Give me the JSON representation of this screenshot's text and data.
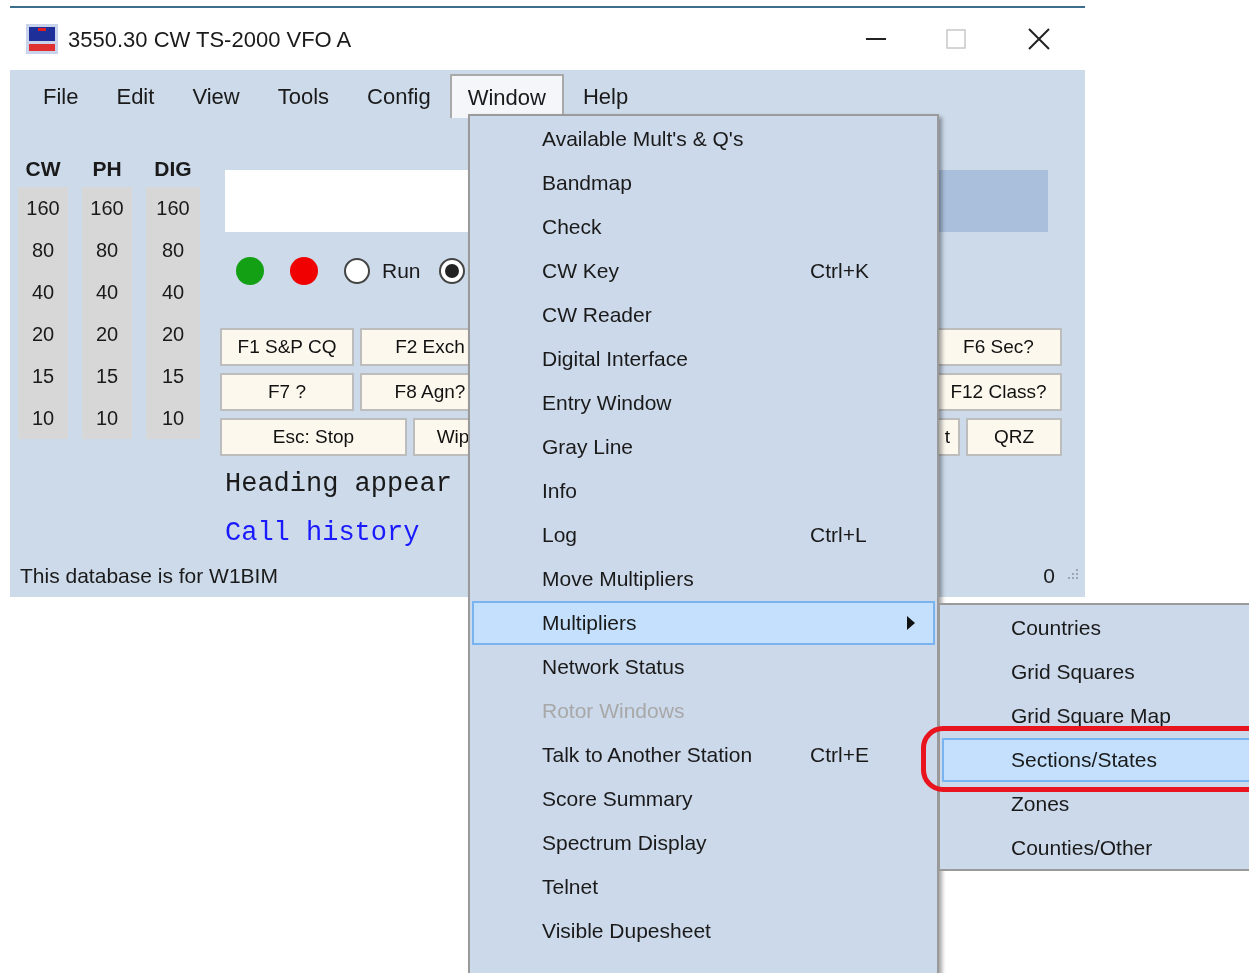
{
  "window": {
    "title": "3550.30 CW TS-2000 VFO A"
  },
  "menu_bar": [
    {
      "label": "File",
      "selected": false
    },
    {
      "label": "Edit",
      "selected": false
    },
    {
      "label": "View",
      "selected": false
    },
    {
      "label": "Tools",
      "selected": false
    },
    {
      "label": "Config",
      "selected": false
    },
    {
      "label": "Window",
      "selected": true
    },
    {
      "label": "Help",
      "selected": false
    }
  ],
  "band_table": [
    {
      "header": "CW",
      "bands": [
        "160",
        "80",
        "40",
        "20",
        "15",
        "10"
      ]
    },
    {
      "header": "PH",
      "bands": [
        "160",
        "80",
        "40",
        "20",
        "15",
        "10"
      ]
    },
    {
      "header": "DIG",
      "bands": [
        "160",
        "80",
        "40",
        "20",
        "15",
        "10"
      ]
    }
  ],
  "indicators": [
    {
      "color": "#14a014"
    },
    {
      "color": "#f00000"
    }
  ],
  "mode_radios": [
    {
      "label": "Run",
      "selected": false
    },
    {
      "selected": true
    }
  ],
  "function_keys_left": [
    [
      {
        "label": "F1 S&P CQ"
      },
      {
        "label": "F2 Exch"
      }
    ],
    [
      {
        "label": "F7 ?"
      },
      {
        "label": "F8 Agn?"
      }
    ],
    [
      {
        "label": "Esc: Stop"
      },
      {
        "label": "Wip"
      }
    ]
  ],
  "function_keys_right": [
    [
      {
        "label": "F6 Sec?"
      }
    ],
    [
      {
        "label": "F12 Class?"
      }
    ],
    [
      {
        "label": "t"
      },
      {
        "label": "QRZ"
      }
    ]
  ],
  "info_lines": [
    {
      "text": "Heading appear",
      "kind": "plain"
    },
    {
      "text": "Call history",
      "kind": "highlight"
    }
  ],
  "status_bar": {
    "text": "This database is for W1BIM",
    "count": "0"
  },
  "window_menu": [
    {
      "label": "Available Mult's & Q's",
      "selected": false,
      "disabled": false
    },
    {
      "label": "Bandmap",
      "selected": false,
      "disabled": false
    },
    {
      "label": "Check",
      "selected": false,
      "disabled": false
    },
    {
      "label": "CW Key",
      "shortcut": "Ctrl+K",
      "selected": false,
      "disabled": false
    },
    {
      "label": "CW Reader",
      "selected": false,
      "disabled": false
    },
    {
      "label": "Digital Interface",
      "selected": false,
      "disabled": false
    },
    {
      "label": "Entry Window",
      "selected": false,
      "disabled": false
    },
    {
      "label": "Gray Line",
      "selected": false,
      "disabled": false
    },
    {
      "label": "Info",
      "selected": false,
      "disabled": false
    },
    {
      "label": "Log",
      "shortcut": "Ctrl+L",
      "selected": false,
      "disabled": false
    },
    {
      "label": "Move Multipliers",
      "selected": false,
      "disabled": false
    },
    {
      "label": "Multipliers",
      "selected": true,
      "disabled": false,
      "submenu": true
    },
    {
      "label": "Network Status",
      "selected": false,
      "disabled": false
    },
    {
      "label": "Rotor Windows",
      "selected": false,
      "disabled": true
    },
    {
      "label": "Talk to Another Station",
      "shortcut": "Ctrl+E",
      "selected": false,
      "disabled": false
    },
    {
      "label": "Score Summary",
      "selected": false,
      "disabled": false
    },
    {
      "label": "Spectrum Display",
      "selected": false,
      "disabled": false
    },
    {
      "label": "Telnet",
      "selected": false,
      "disabled": false
    },
    {
      "label": "Visible Dupesheet",
      "selected": false,
      "disabled": false
    }
  ],
  "submenu": [
    {
      "label": "Countries",
      "selected": false
    },
    {
      "label": "Grid Squares",
      "selected": false
    },
    {
      "label": "Grid Square Map",
      "selected": false
    },
    {
      "label": "Sections/States",
      "selected": true
    },
    {
      "label": "Zones",
      "selected": false
    },
    {
      "label": "Counties/Other",
      "selected": false
    }
  ]
}
